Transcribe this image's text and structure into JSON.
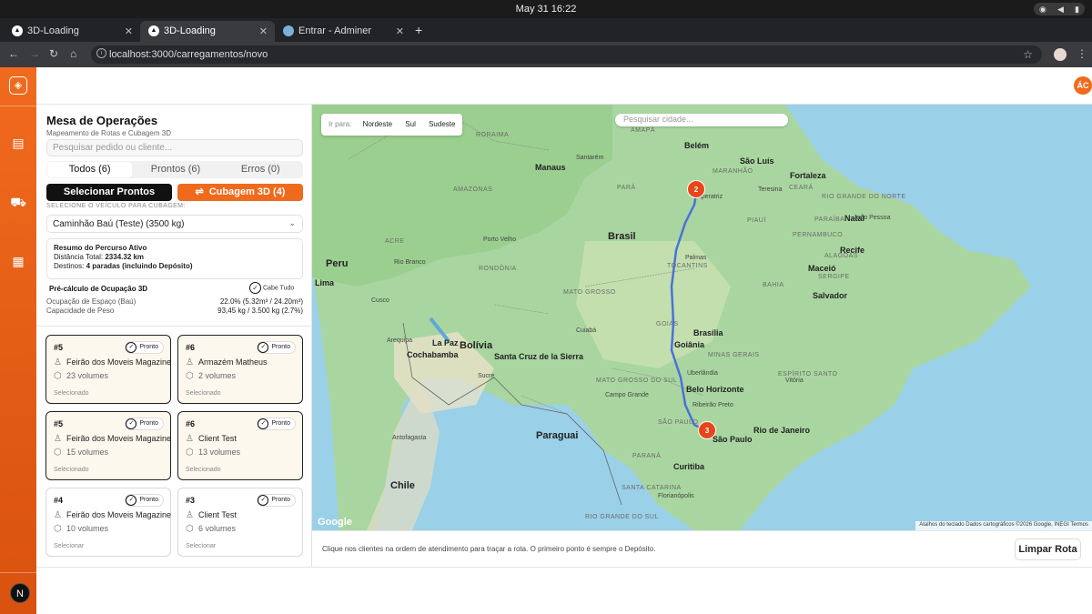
{
  "os": {
    "clock": "May 31  16:22",
    "status_icons": [
      "wifi-icon",
      "volume-icon",
      "battery-icon"
    ]
  },
  "browser": {
    "tabs": [
      {
        "label": "3D-Loading",
        "active": false
      },
      {
        "label": "3D-Loading",
        "active": true
      },
      {
        "label": "Entrar - Adminer",
        "active": false
      }
    ],
    "url": "localhost:3000/carregamentos/novo"
  },
  "user": {
    "initials": "ÁC"
  },
  "sidebar": {
    "bottom_badge": "N"
  },
  "panel": {
    "title": "Mesa de Operações",
    "subtitle": "Mapeamento de Rotas e Cubagem 3D",
    "search_placeholder": "Pesquisar pedido ou cliente...",
    "tabs": [
      {
        "label": "Todos (6)",
        "active": true
      },
      {
        "label": "Prontos (6)",
        "active": false
      },
      {
        "label": "Erros (0)",
        "active": false
      }
    ],
    "select_ready_label": "Selecionar Prontos",
    "cubage_label": "Cubagem 3D (4)",
    "vehicle_label": "SELECIONE O VEÍCULO PARA CUBAGEM:",
    "vehicle_value": "Caminhão Baú (Teste) (3500 kg)",
    "summary": {
      "title": "Resumo do Percurso Ativo",
      "distance_label": "Distância Total:",
      "distance_value": "2334.32 km",
      "destinations_label": "Destinos:",
      "destinations_value": "4 paradas (incluindo Depósito)"
    },
    "occupancy": {
      "title": "Pré-cálculo de Ocupação 3D",
      "badge": "Cabe Tudo",
      "space_label": "Ocupação de Espaço (Baú)",
      "space_value": "22.0% (5.32m³ / 24.20m³)",
      "weight_label": "Capacidade de Peso",
      "weight_value": "93,45 kg / 3.500 kg (2.7%)"
    },
    "cards": [
      {
        "id": "#5",
        "badge": "Pronto",
        "client": "Feirão dos Moveis Magazine",
        "volumes": "23 volumes",
        "status": "Selecionado",
        "selected": true
      },
      {
        "id": "#6",
        "badge": "Pronto",
        "client": "Armazém Matheus",
        "volumes": "2 volumes",
        "status": "Selecionado",
        "selected": true
      },
      {
        "id": "#5",
        "badge": "Pronto",
        "client": "Feirão dos Moveis Magazine",
        "volumes": "15 volumes",
        "status": "Selecionado",
        "selected": true
      },
      {
        "id": "#6",
        "badge": "Pronto",
        "client": "Client Test",
        "volumes": "13 volumes",
        "status": "Selecionado",
        "selected": true
      },
      {
        "id": "#4",
        "badge": "Pronto",
        "client": "Feirão dos Moveis Magazine",
        "volumes": "10 volumes",
        "status": "Selecionar",
        "selected": false
      },
      {
        "id": "#3",
        "badge": "Pronto",
        "client": "Client Test",
        "volumes": "6 volumes",
        "status": "Selecionar",
        "selected": false
      }
    ]
  },
  "map": {
    "goto_label": "Ir para:",
    "goto_buttons": [
      "Nordeste",
      "Sul",
      "Sudeste"
    ],
    "search_placeholder": "Pesquisar cidade...",
    "country_labels": [
      "Brasil",
      "Peru",
      "Bolívia",
      "Paraguai",
      "Chile"
    ],
    "city_labels": [
      "Manaus",
      "Belém",
      "São Luís",
      "Fortaleza",
      "Natal",
      "João Pessoa",
      "Recife",
      "Maceió",
      "Salvador",
      "Palmas",
      "Porto Velho",
      "Rio Branco",
      "Lima",
      "La Paz",
      "Cochabamba",
      "Santa Cruz de la Sierra",
      "Cuiabá",
      "Brasília",
      "Goiânia",
      "Campo Grande",
      "Uberlândia",
      "Belo Horizonte",
      "Ribeirão Preto",
      "Rio de Janeiro",
      "São Paulo",
      "Curitiba",
      "Florianópolis",
      "Arequipa",
      "Antofagasta",
      "Cusco",
      "Sucre",
      "Imperatriz",
      "Santarém",
      "Teresina",
      "Vitória"
    ],
    "state_labels": [
      "AMAZONAS",
      "PARÁ",
      "MARANHÃO",
      "PIAUÍ",
      "CEARÁ",
      "RIO GRANDE DO NORTE",
      "PARAÍBA",
      "PERNAMBUCO",
      "ALAGOAS",
      "SERGIPE",
      "BAHIA",
      "TOCANTINS",
      "MATO GROSSO",
      "RONDÔNIA",
      "ACRE",
      "GOIÁS",
      "MINAS GERAIS",
      "ESPÍRITO SANTO",
      "MATO GROSSO DO SUL",
      "SÃO PAULO",
      "PARANÁ",
      "SANTA CATARINA",
      "RIO GRANDE DO SUL",
      "AMAPÁ",
      "RORAIMA"
    ],
    "markers": [
      "2",
      "3"
    ],
    "google": "Google",
    "attribution": "Atalhos do teclado   Dados cartográficos ©2026 Google, INEGI   Termos"
  },
  "footer": {
    "hint": "Clique nos clientes na ordem de atendimento para traçar a rota. O primeiro ponto é sempre o Depósito.",
    "clear_label": "Limpar Rota"
  },
  "colors": {
    "accent": "#f06a1e",
    "route": "#4a72d8",
    "marker": "#e8461a",
    "land": "#a9d6a0",
    "water": "#9ad0e8"
  }
}
